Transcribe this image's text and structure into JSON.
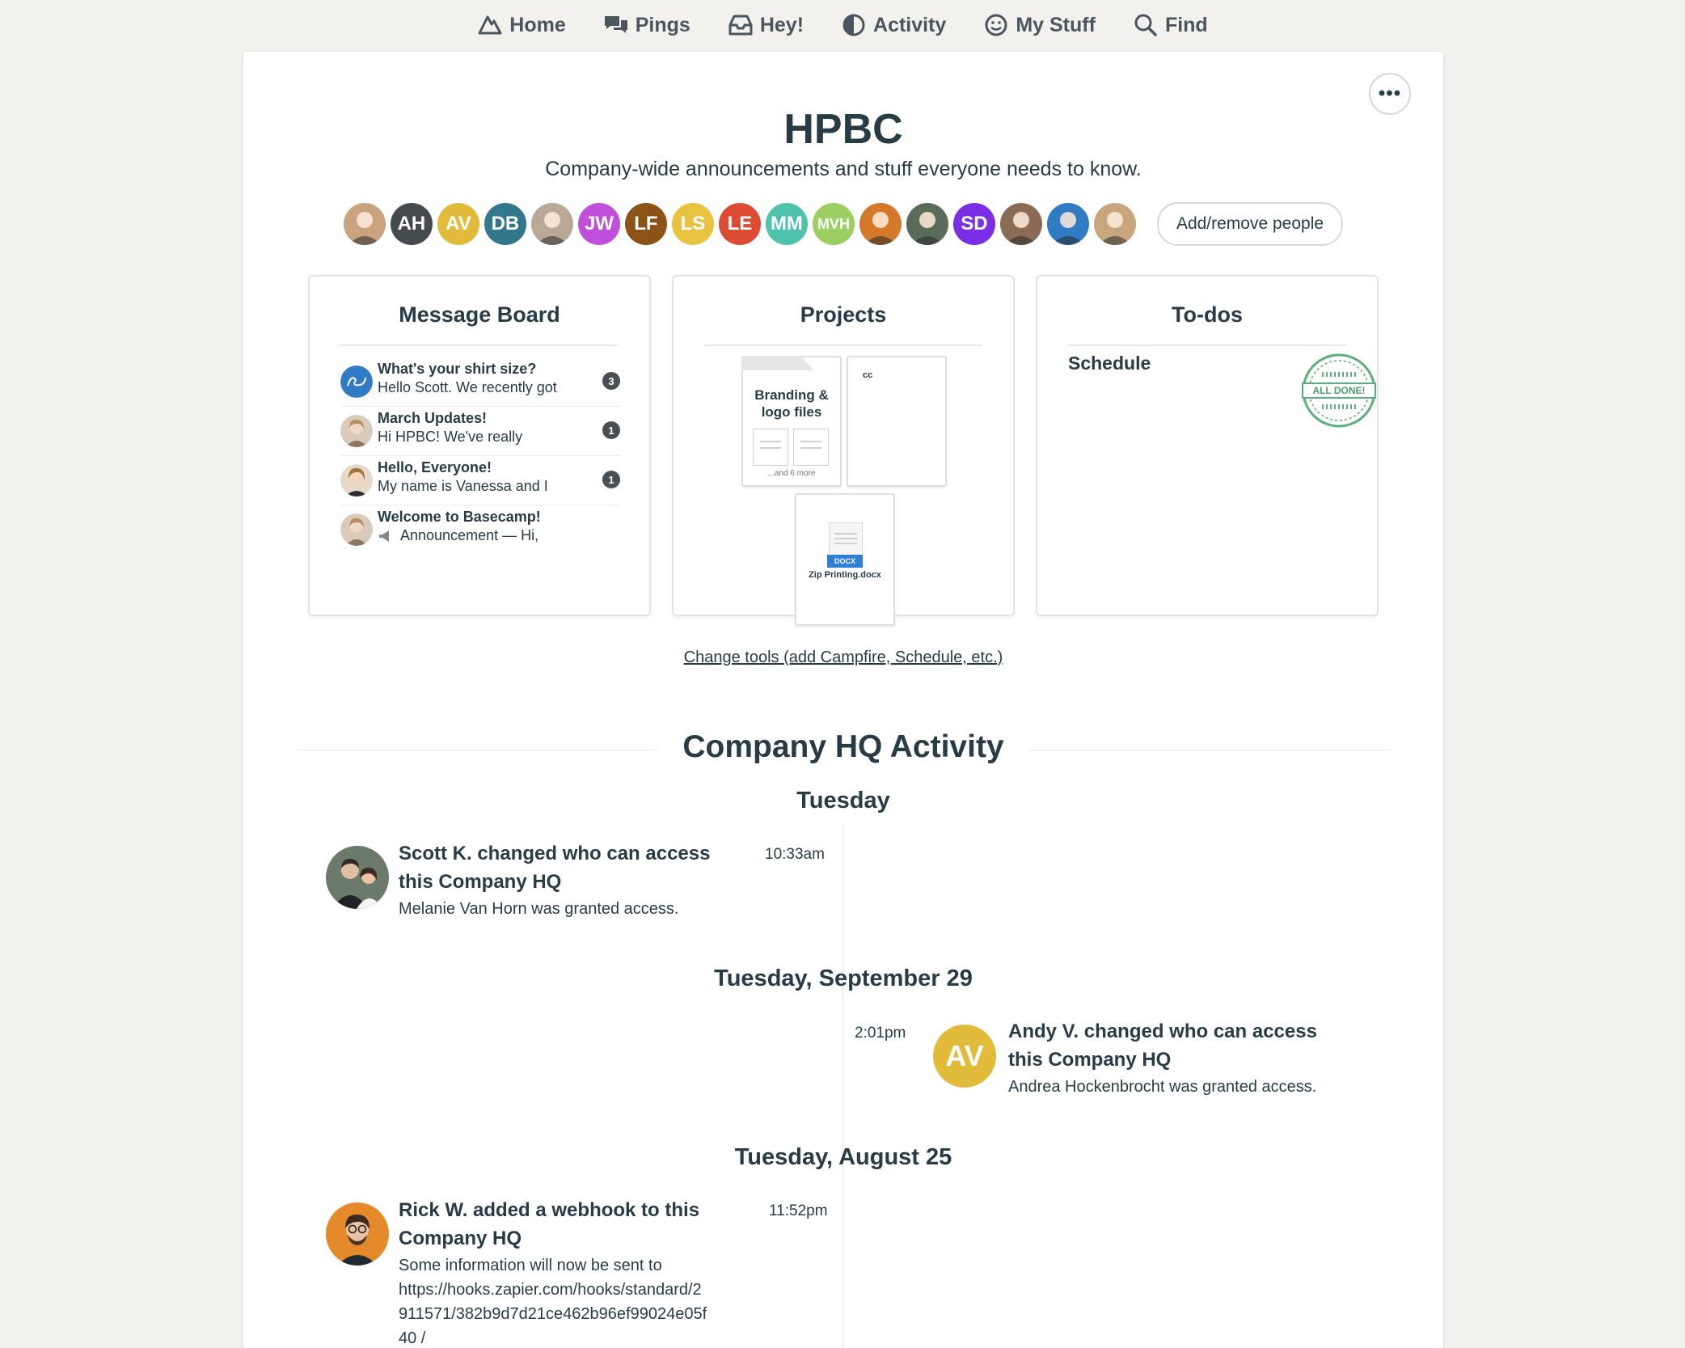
{
  "nav": {
    "home": "Home",
    "pings": "Pings",
    "hey": "Hey!",
    "activity": "Activity",
    "mystuff": "My Stuff",
    "find": "Find"
  },
  "header": {
    "more": "•••",
    "title": "HPBC",
    "subtitle": "Company-wide announcements and stuff everyone needs to know.",
    "add_people": "Add/remove people"
  },
  "people": [
    {
      "initials": "",
      "color": "#c9a27e"
    },
    {
      "initials": "AH",
      "color": "#454a4f"
    },
    {
      "initials": "AV",
      "color": "#e3bb3a"
    },
    {
      "initials": "DB",
      "color": "#33778a"
    },
    {
      "initials": "",
      "color": "#b9a896"
    },
    {
      "initials": "JW",
      "color": "#c04fd9"
    },
    {
      "initials": "LF",
      "color": "#8c5316"
    },
    {
      "initials": "LS",
      "color": "#e9c340"
    },
    {
      "initials": "LE",
      "color": "#dc4b32"
    },
    {
      "initials": "MM",
      "color": "#4fc2ad"
    },
    {
      "initials": "MVH",
      "color": "#9bcf62"
    },
    {
      "initials": "",
      "color": "#d4782a"
    },
    {
      "initials": "",
      "color": "#5a6b5c"
    },
    {
      "initials": "SD",
      "color": "#7a2fe6"
    },
    {
      "initials": "",
      "color": "#8b6b56"
    },
    {
      "initials": "",
      "color": "#2f7bc4"
    },
    {
      "initials": "",
      "color": "#c7a57d"
    }
  ],
  "message_board": {
    "title": "Message Board",
    "items": [
      {
        "title": "What's your shirt size?",
        "preview": "Hello Scott. We recently got",
        "count": "3"
      },
      {
        "title": "March Updates!",
        "preview": "Hi HPBC! We've really",
        "count": "1"
      },
      {
        "title": "Hello, Everyone!",
        "preview": "My name is Vanessa and I",
        "count": "1"
      },
      {
        "title": "Welcome to Basecamp!",
        "preview": "Announcement — Hi,",
        "count": ""
      }
    ]
  },
  "projects": {
    "title": "Projects",
    "folder_name": "Branding & logo files",
    "folder_more": "...and 6 more",
    "doc_label": "cc",
    "file_badge": "DOCX",
    "file_name": "Zip Printing.docx"
  },
  "todos": {
    "title": "To-dos",
    "list_name": "Schedule",
    "stamp": "ALL DONE!"
  },
  "change_tools": "Change tools (add Campfire, Schedule, etc.)",
  "activity": {
    "title": "Company HQ Activity",
    "days": [
      {
        "label": "Tuesday",
        "event": {
          "title": "Scott K. changed who can access this Company HQ",
          "body": "Melanie Van Horn was granted access.",
          "time": "10:33am"
        }
      },
      {
        "label": "Tuesday, September 29",
        "event": {
          "initials": "AV",
          "title": "Andy V. changed who can access this Company HQ",
          "body": "Andrea Hockenbrocht was granted access.",
          "time": "2:01pm"
        }
      },
      {
        "label": "Tuesday, August 25",
        "event": {
          "title": "Rick W. added a webhook to this Company HQ",
          "body_l1": "Some information will now be sent to",
          "body_l2": "https://hooks.zapier.com/hooks/standard/2",
          "body_l3": "911571/382b9d7d21ce462b96ef99024e05f",
          "body_l4": "40 /",
          "time": "11:52pm"
        }
      }
    ]
  }
}
